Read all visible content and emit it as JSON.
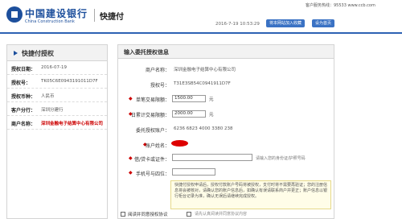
{
  "header": {
    "bank_name_cn": "中国建设银行",
    "bank_name_en": "China Construction Bank",
    "product": "快捷付",
    "hotline": "客户服务热线：95533  www.ccb.com",
    "datetime": "2016-7-19 10:53:29",
    "buttons": {
      "favorite": "将本网站加入收藏",
      "home": "设为首页"
    }
  },
  "left_panel": {
    "title": "快捷付授权",
    "rows": [
      {
        "label": "授权日期：",
        "value": "2016-07-19"
      },
      {
        "label": "授权号：",
        "value": "TK05C6E0943191011D7F"
      },
      {
        "label": "授权币种：",
        "value": "人民币"
      },
      {
        "label": "客户分行：",
        "value": "深圳分建行"
      },
      {
        "label": "商户名称：",
        "value": "深圳金融电子结算中心有限公司"
      }
    ]
  },
  "right_panel": {
    "title": "输入委托授权信息",
    "merchant_name": {
      "label": "商户名称：",
      "value": "深圳金融电子结算中心有限公司"
    },
    "auth_no": {
      "label": "授权号：",
      "value": "T31E3SB54C0941911D7F"
    },
    "single_limit": {
      "label": "单笔交易限额：",
      "value": "1500.00",
      "unit": "元"
    },
    "daily_limit": {
      "label": "日累计交易限额：",
      "value": "2000.00",
      "unit": "元"
    },
    "service_account": {
      "label": "委托授权账户：",
      "value": "6236 6823 4000 3380 238"
    },
    "account_name": {
      "label": "账户姓名："
    },
    "id_number": {
      "label": "借/贷卡或证件：",
      "placeholder": "",
      "hint": "请输入您的身份证/护照号码"
    },
    "phone": {
      "label": "手机号与四位：",
      "placeholder": ""
    },
    "notice": "快捷付授权申请后，授权付款账户号码将被授权，支付时将不需要再验证；您的注册信息将会被核对，请确认您的账户信息后，如确认有误请联系商户并更正；账户信息以银行柜台记录为准，确认无误后请继续完成授权。",
    "agree": {
      "label": "阅读并同意授权协议",
      "note": "请先认真阅读并同意协议内容"
    }
  }
}
